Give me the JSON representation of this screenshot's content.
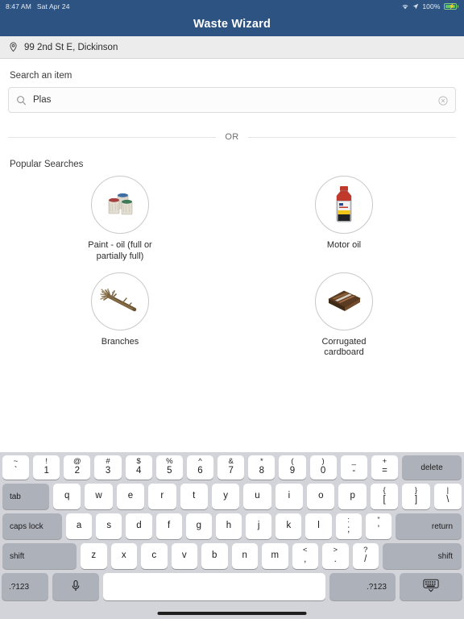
{
  "status_bar": {
    "time": "8:47 AM",
    "date": "Sat Apr 24",
    "battery_percent": "100%",
    "wifi_icon": "wifi-icon",
    "location_icon": "location-arrow-icon",
    "battery_icon": "battery-charging-icon"
  },
  "header": {
    "title": "Waste Wizard"
  },
  "location": {
    "pin_icon": "map-pin-icon",
    "address": "99 2nd St E, Dickinson"
  },
  "search": {
    "label": "Search an item",
    "value": "Plas",
    "placeholder": "Search an item",
    "search_icon": "search-icon",
    "clear_icon": "clear-circle-icon"
  },
  "divider": {
    "text": "OR"
  },
  "popular": {
    "label": "Popular Searches",
    "items": [
      {
        "caption": "Paint - oil (full or partially full)",
        "icon": "paint-cans-icon"
      },
      {
        "caption": "Motor oil",
        "icon": "motor-oil-bottle-icon"
      },
      {
        "caption": "Branches",
        "icon": "branches-icon"
      },
      {
        "caption": "Corrugated cardboard",
        "icon": "cardboard-box-icon"
      }
    ]
  },
  "colors": {
    "header_navy": "#2d5382",
    "location_bar": "#ececec",
    "keyboard_bg": "#d2d4d9",
    "key_white": "#ffffff",
    "key_dark": "#adb1ba",
    "battery_green": "#5ac85a"
  },
  "keyboard": {
    "rows": [
      {
        "name": "number-row",
        "keys": [
          {
            "sup": "~",
            "sub": "`"
          },
          {
            "sup": "!",
            "sub": "1"
          },
          {
            "sup": "@",
            "sub": "2"
          },
          {
            "sup": "#",
            "sub": "3"
          },
          {
            "sup": "$",
            "sub": "4"
          },
          {
            "sup": "%",
            "sub": "5"
          },
          {
            "sup": "^",
            "sub": "6"
          },
          {
            "sup": "&",
            "sub": "7"
          },
          {
            "sup": "*",
            "sub": "8"
          },
          {
            "sup": "(",
            "sub": "9"
          },
          {
            "sup": ")",
            "sub": "0"
          },
          {
            "sup": "_",
            "sub": "-"
          },
          {
            "sup": "+",
            "sub": "="
          },
          {
            "label": "delete"
          }
        ]
      },
      {
        "name": "qwerty-row",
        "keys": [
          {
            "label": "tab"
          },
          {
            "label": "q"
          },
          {
            "label": "w"
          },
          {
            "label": "e"
          },
          {
            "label": "r"
          },
          {
            "label": "t"
          },
          {
            "label": "y"
          },
          {
            "label": "u"
          },
          {
            "label": "i"
          },
          {
            "label": "o"
          },
          {
            "label": "p"
          },
          {
            "sup": "{",
            "sub": "["
          },
          {
            "sup": "}",
            "sub": "]"
          },
          {
            "sup": "|",
            "sub": "\\"
          }
        ]
      },
      {
        "name": "home-row",
        "keys": [
          {
            "label": "caps lock"
          },
          {
            "label": "a"
          },
          {
            "label": "s"
          },
          {
            "label": "d"
          },
          {
            "label": "f"
          },
          {
            "label": "g"
          },
          {
            "label": "h"
          },
          {
            "label": "j"
          },
          {
            "label": "k"
          },
          {
            "label": "l"
          },
          {
            "sup": ":",
            "sub": ";"
          },
          {
            "sup": "”",
            "sub": "’"
          },
          {
            "label": "return"
          }
        ]
      },
      {
        "name": "shift-row",
        "keys": [
          {
            "label": "shift"
          },
          {
            "label": "z"
          },
          {
            "label": "x"
          },
          {
            "label": "c"
          },
          {
            "label": "v"
          },
          {
            "label": "b"
          },
          {
            "label": "n"
          },
          {
            "label": "m"
          },
          {
            "sup": "<",
            "sub": ","
          },
          {
            "sup": ">",
            "sub": "."
          },
          {
            "sup": "?",
            "sub": "/"
          },
          {
            "label": "shift"
          }
        ]
      },
      {
        "name": "bottom-row",
        "keys": [
          {
            "label": ".?123"
          },
          {
            "label": "",
            "icon": "microphone-icon"
          },
          {
            "label": ""
          },
          {
            "label": ".?123"
          },
          {
            "label": "",
            "icon": "keyboard-dismiss-icon"
          }
        ]
      }
    ]
  }
}
